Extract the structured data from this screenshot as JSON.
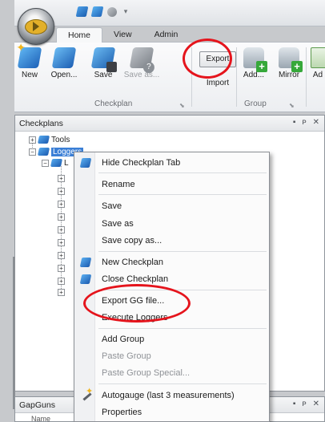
{
  "ribbon": {
    "tabs": [
      "Home",
      "View",
      "Admin"
    ],
    "buttons": {
      "new": "New",
      "open": "Open...",
      "save": "Save",
      "save_as": "Save as...",
      "export": "Export",
      "import": "Import",
      "add": "Add...",
      "mirror": "Mirror",
      "ad": "Ad"
    },
    "groups": {
      "checkplan": "Checkplan",
      "group": "Group"
    }
  },
  "checkplans": {
    "title": "Checkplans",
    "tree": {
      "tools": "Tools",
      "loggers": "Loggers",
      "child_prefix": "L"
    }
  },
  "context_menu": {
    "items": [
      "Hide Checkplan Tab",
      "Rename",
      "Save",
      "Save as",
      "Save copy as...",
      "New Checkplan",
      "Close Checkplan",
      "Export GG file...",
      "Execute Loggers",
      "Add Group",
      "Paste Group",
      "Paste Group Special...",
      "Autogauge (last 3 measurements)",
      "Properties"
    ]
  },
  "gapguns": {
    "title": "GapGuns",
    "column_name": "Name"
  },
  "colors": {
    "highlight_ring": "#e5141c",
    "selection": "#3b7fd6"
  }
}
